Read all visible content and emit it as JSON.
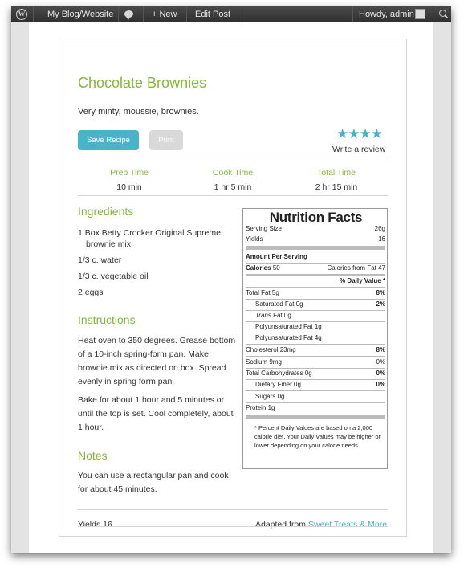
{
  "admin_bar": {
    "site_name": "My Blog/Website",
    "new_label": "+ New",
    "edit_label": "Edit Post",
    "greeting": "Howdy, admin",
    "wp_icon": "wordpress-icon",
    "comments_icon": "speech-bubble-icon",
    "search_icon": "magnifier-icon"
  },
  "recipe": {
    "title": "Chocolate Brownies",
    "summary": "Very minty, moussie, brownies.",
    "save_label": "Save Recipe",
    "print_label": "Print",
    "rating": 4,
    "rating_max": 4,
    "review_label": "Write a review",
    "times": [
      {
        "label": "Prep Time",
        "value": "10 min"
      },
      {
        "label": "Cook Time",
        "value": "1 hr 5 min"
      },
      {
        "label": "Total Time",
        "value": "2 hr 15 min"
      }
    ],
    "ingredients_heading": "Ingredients",
    "ingredients": [
      "1 Box Betty Crocker Original Supreme",
      "brownie mix",
      "1/3 c. water",
      "1/3 c. vegetable oil",
      "2 eggs"
    ],
    "instructions_heading": "Instructions",
    "instructions": [
      "Heat oven to 350 degrees. Grease bottom of a 10-inch spring-form pan. Make brownie mix as directed on box. Spread evenly in spring form pan.",
      "Bake for about 1 hour and 5 minutes or until the top is set. Cool completely, about 1 hour."
    ],
    "notes_heading": "Notes",
    "notes": "You can use a rectangular pan and cook for about 45 minutes.",
    "yields": "Yields 16",
    "adapted_from_label": "Adapted from",
    "source_name": "Sweet Treats & More",
    "accent_color": "#85b73a",
    "button_color": "#4ab3c8"
  },
  "nutrition": {
    "title": "Nutrition Facts",
    "serving_size_label": "Serving Size",
    "serving_size": "26g",
    "yields_label": "Yields",
    "yields": "16",
    "amount_per_serving": "Amount Per Serving",
    "calories_label": "Calories",
    "calories": "50",
    "calories_fat": "Calories from Fat 47",
    "dv_header": "% Daily Value *",
    "total_fat": "Total Fat 5g",
    "total_fat_dv": "8%",
    "sat_fat": "Saturated Fat 0g",
    "sat_fat_dv": "2%",
    "trans_fat_italic": "Trans",
    "trans_fat_rest": " Fat 0g",
    "poly_fat": "Polyunsaturated Fat 1g",
    "mono_fat": "Polyunsaturated Fat 4g",
    "cholesterol": "Cholesterol 23mg",
    "cholesterol_dv": "8%",
    "sodium": "Sodium 9mg",
    "sodium_dv": "0%",
    "carbs": "Total Carbohydrates 0g",
    "carbs_dv": "0%",
    "fiber": "Dietary Fiber 0g",
    "fiber_dv": "0%",
    "sugars": "Sugars 0g",
    "protein": "Protein 1g",
    "footnote": "* Percent Daily Values are based on a 2,000 calorie diet. Your Daily Values may be higher or lower depending on your calorie needs."
  }
}
